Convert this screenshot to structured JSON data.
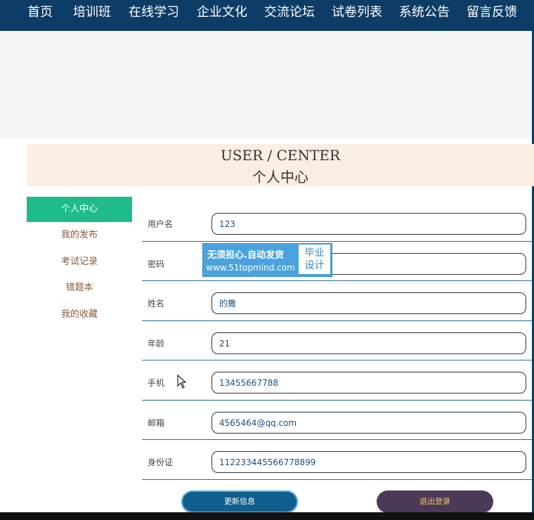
{
  "nav": {
    "items": [
      "首页",
      "培训班",
      "在线学习",
      "企业文化",
      "交流论坛",
      "试卷列表",
      "系统公告",
      "留言反馈"
    ]
  },
  "header": {
    "title_en": "USER / CENTER",
    "title_cn": "个人中心"
  },
  "sidebar": {
    "items": [
      {
        "label": "个人中心",
        "active": true
      },
      {
        "label": "我的发布",
        "active": false
      },
      {
        "label": "考试记录",
        "active": false
      },
      {
        "label": "错题本",
        "active": false
      },
      {
        "label": "我的收藏",
        "active": false
      }
    ]
  },
  "form": {
    "username": {
      "label": "用户名",
      "value": "123"
    },
    "password": {
      "label": "密码",
      "value": ""
    },
    "name": {
      "label": "姓名",
      "value": "的撒"
    },
    "age": {
      "label": "年龄",
      "value": "21"
    },
    "phone": {
      "label": "手机",
      "value": "13455667788"
    },
    "email": {
      "label": "邮箱",
      "value": "4565464@qq.com"
    },
    "id_card": {
      "label": "身份证",
      "value": "112233445566778899"
    }
  },
  "buttons": {
    "update": "更新信息",
    "logout": "退出登录"
  },
  "watermark": {
    "line1": "无须担心.自动发货",
    "line2": "www.51topmind.com",
    "badge_line1": "毕业",
    "badge_line2": "设计"
  },
  "colors": {
    "nav_bg": "#0d3d66",
    "sidebar_active": "#1fbb8c",
    "header_bg": "#fdeee4",
    "update_button": "#0f5e8e",
    "logout_button": "#4a3a58"
  }
}
